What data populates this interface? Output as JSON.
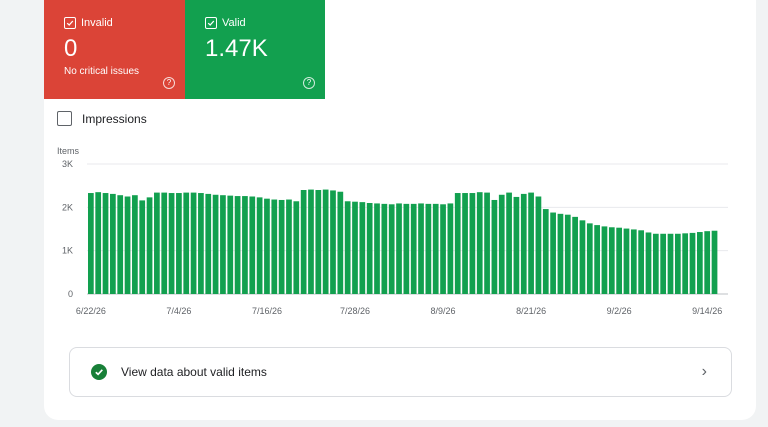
{
  "tiles": {
    "invalid": {
      "label": "Invalid",
      "value": "0",
      "sub": "No critical issues",
      "color": "#db4437"
    },
    "valid": {
      "label": "Valid",
      "value": "1.47K",
      "color": "#12a04f"
    }
  },
  "impressions_label": "Impressions",
  "link": {
    "label": "View data about valid items"
  },
  "chart_data": {
    "type": "bar",
    "ylabel": "Items",
    "ylim": [
      0,
      3000
    ],
    "y_ticks": [
      "0",
      "1K",
      "2K",
      "3K"
    ],
    "x_ticks": [
      "6/22/26",
      "7/4/26",
      "7/16/26",
      "7/28/26",
      "8/9/26",
      "8/21/26",
      "9/2/26",
      "9/14/26"
    ],
    "color": "#12a04f",
    "values": [
      2330,
      2350,
      2330,
      2310,
      2280,
      2250,
      2280,
      2160,
      2230,
      2340,
      2340,
      2330,
      2330,
      2340,
      2340,
      2330,
      2310,
      2290,
      2280,
      2270,
      2260,
      2260,
      2250,
      2230,
      2200,
      2180,
      2170,
      2180,
      2140,
      2400,
      2410,
      2400,
      2410,
      2390,
      2360,
      2140,
      2130,
      2120,
      2100,
      2090,
      2080,
      2070,
      2090,
      2080,
      2080,
      2090,
      2080,
      2080,
      2070,
      2090,
      2330,
      2330,
      2330,
      2350,
      2340,
      2170,
      2290,
      2340,
      2240,
      2310,
      2340,
      2250,
      1960,
      1880,
      1850,
      1830,
      1780,
      1700,
      1630,
      1590,
      1560,
      1540,
      1530,
      1510,
      1490,
      1470,
      1420,
      1390,
      1390,
      1390,
      1390,
      1400,
      1410,
      1430,
      1450,
      1460
    ]
  }
}
